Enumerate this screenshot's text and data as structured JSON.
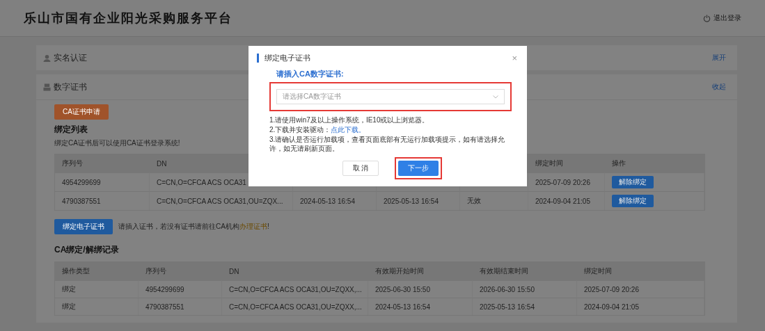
{
  "header": {
    "title": "乐山市国有企业阳光采购服务平台",
    "logout": "退出登录"
  },
  "sections": [
    {
      "title": "实名认证",
      "toggle": "展开",
      "expanded": false
    },
    {
      "title": "数字证书",
      "toggle": "收起",
      "expanded": true
    }
  ],
  "apply_button": "CA证书申请",
  "bound_list": {
    "title": "绑定列表",
    "subtitle": "绑定CA证书后可以使用CA证书登录系统!",
    "columns": {
      "serial": "序列号",
      "dn": "DN",
      "bind_time": "绑定时间",
      "action": "操作"
    },
    "rows": [
      {
        "serial": "4954299699",
        "dn": "C=CN,O=CFCA ACS OCA31",
        "bind_time": "2025-07-09 20:26",
        "action": "解除绑定"
      },
      {
        "serial": "4790387551",
        "dn": "C=CN,O=CFCA ACS OCA31,OU=ZQX...",
        "column_3": "2024-05-13 16:54",
        "column_4": "2025-05-13 16:54",
        "column_5": "无效",
        "bind_time": "2024-09-04 21:05",
        "action": "解除绑定"
      }
    ]
  },
  "bind_button": "绑定电子证书",
  "bind_note": "请插入证书，若没有证书请前往CA机构",
  "bind_note_link": "办理证书",
  "bind_note_end": "!",
  "records": {
    "title": "CA绑定/解绑记录",
    "columns": [
      "操作类型",
      "序列号",
      "DN",
      "有效期开始时间",
      "有效期结束时间",
      "绑定时间"
    ],
    "rows": [
      [
        "绑定",
        "4954299699",
        "C=CN,O=CFCA ACS OCA31,OU=ZQXX,...",
        "2025-06-30 15:50",
        "2026-06-30 15:50",
        "2025-07-09 20:26"
      ],
      [
        "绑定",
        "4790387551",
        "C=CN,O=CFCA ACS OCA31,OU=ZQXX,...",
        "2024-05-13 16:54",
        "2025-05-13 16:54",
        "2024-09-04 21:05"
      ]
    ]
  },
  "modal": {
    "title": "绑定电子证书",
    "close": "×",
    "label": "请插入CA数字证书:",
    "select": {
      "placeholder": "请选择CA数字证书",
      "highlighted": true
    },
    "notes": [
      {
        "text": "1.请使用win7及以上操作系统，IE10或以上浏览器。"
      },
      {
        "text": "2.下载并安装驱动：",
        "link": "点此下载。"
      },
      {
        "text": "3.请确认是否运行加载项，查看页面底部有无运行加载项提示，如有请选择允许，如无请刷新页面。"
      }
    ],
    "cancel": {
      "label": "取 消",
      "highlighted": false
    },
    "next": {
      "label": "下一步",
      "highlighted": true
    }
  }
}
